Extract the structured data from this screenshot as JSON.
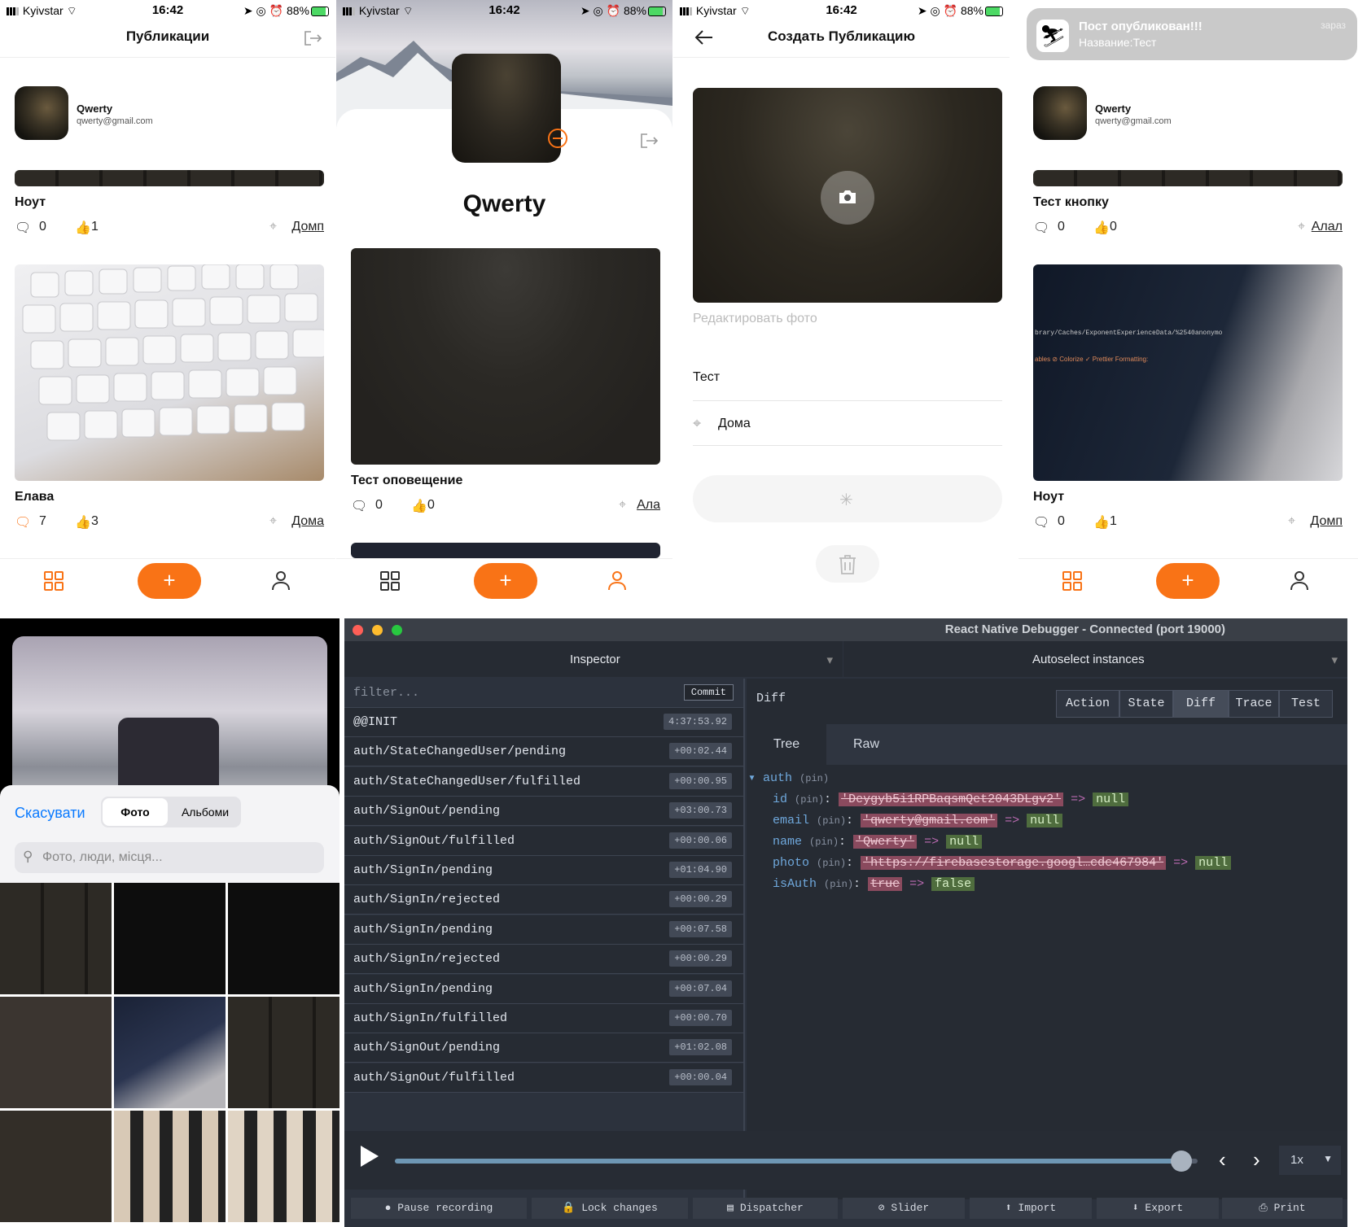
{
  "status": {
    "carrier": "Kyivstar",
    "time": "16:42",
    "battery": "88%"
  },
  "s1": {
    "title": "Публикации",
    "profile_name": "Qwerty",
    "profile_email": "qwerty@gmail.com",
    "post1": {
      "title": "Ноут",
      "comments": "0",
      "likes": "1",
      "location": "Домп"
    },
    "post2": {
      "title": "Елава",
      "comments": "7",
      "likes": "3",
      "location": "Дома"
    }
  },
  "s2": {
    "name": "Qwerty",
    "post1": {
      "title": "Тест оповещение",
      "comments": "0",
      "likes": "0",
      "location": "Ала"
    }
  },
  "s3": {
    "title": "Создать Публикацию",
    "edit_photo": "Редактировать фото",
    "name_value": "Тест",
    "location_value": "Дома"
  },
  "s4": {
    "notif_title": "Пост опубликован!!!",
    "notif_body": "Название:Тест",
    "notif_time": "зараз",
    "profile_name": "Qwerty",
    "profile_email": "qwerty@gmail.com",
    "post1": {
      "title": "Тест кнопку",
      "comments": "0",
      "likes": "0",
      "location": "Алал"
    },
    "post2": {
      "title": "Ноут",
      "comments": "0",
      "likes": "1",
      "location": "Домп"
    },
    "screen_text1": "brary/Caches/ExponentExperienceData/%2540anonymo",
    "screen_text2": "ables ⊘ Colorize ✓ Prettier Formatting:"
  },
  "picker": {
    "cancel": "Скасувати",
    "seg_photo": "Фото",
    "seg_albums": "Альбоми",
    "search_placeholder": "Фото, люди, місця..."
  },
  "debugger": {
    "window_title": "React Native Debugger - Connected (port 19000)",
    "inspector_label": "Inspector",
    "autoselect_label": "Autoselect instances",
    "filter_placeholder": "filter...",
    "commit_label": "Commit",
    "diff_label": "Diff",
    "tabs": [
      "Action",
      "State",
      "Diff",
      "Trace",
      "Test"
    ],
    "subtabs": [
      "Tree",
      "Raw"
    ],
    "actions": [
      {
        "name": "@@INIT",
        "time": "4:37:53.92"
      },
      {
        "name": "auth/StateChangedUser/pending",
        "time": "+00:02.44"
      },
      {
        "name": "auth/StateChangedUser/fulfilled",
        "time": "+00:00.95"
      },
      {
        "name": "auth/SignOut/pending",
        "time": "+03:00.73"
      },
      {
        "name": "auth/SignOut/fulfilled",
        "time": "+00:00.06"
      },
      {
        "name": "auth/SignIn/pending",
        "time": "+01:04.90"
      },
      {
        "name": "auth/SignIn/rejected",
        "time": "+00:00.29"
      },
      {
        "name": "auth/SignIn/pending",
        "time": "+00:07.58"
      },
      {
        "name": "auth/SignIn/rejected",
        "time": "+00:00.29"
      },
      {
        "name": "auth/SignIn/pending",
        "time": "+00:07.04"
      },
      {
        "name": "auth/SignIn/fulfilled",
        "time": "+00:00.70"
      },
      {
        "name": "auth/SignOut/pending",
        "time": "+01:02.08"
      },
      {
        "name": "auth/SignOut/fulfilled",
        "time": "+00:00.04"
      }
    ],
    "diff": {
      "root": "auth",
      "pin": "(pin)",
      "arrow": "=>",
      "rows": [
        {
          "key": "id",
          "old": "'Deygyb5i1RPBaqsmQet2043DLgv2'",
          "new": "null"
        },
        {
          "key": "email",
          "old": "'qwerty@gmail.com'",
          "new": "null"
        },
        {
          "key": "name",
          "old": "'Qwerty'",
          "new": "null"
        },
        {
          "key": "photo",
          "old": "'https://firebasestorage.googl…cdc467984'",
          "new": "null"
        },
        {
          "key": "isAuth",
          "old": "true",
          "new": "false"
        }
      ]
    },
    "speed": "1x",
    "slider_progress": 0.98,
    "bottom_buttons": [
      "Pause recording",
      "Lock changes",
      "Dispatcher",
      "Slider",
      "Import",
      "Export",
      "Print"
    ]
  },
  "colors": {
    "accent": "#f97316",
    "debugger_bg": "#2c323d",
    "old_value": "#8a4a5e",
    "new_value": "#4f6d3e"
  }
}
